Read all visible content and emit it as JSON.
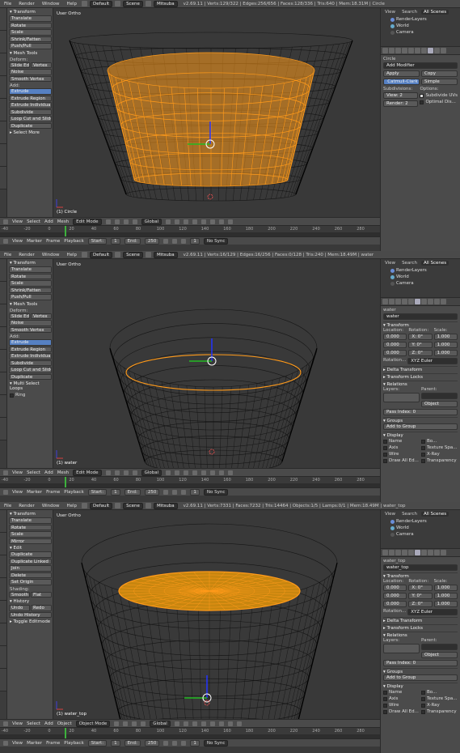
{
  "colors": {
    "selection": "#ff9a1a",
    "wire": "#111111",
    "viewport_bg": "#393939",
    "accent": "#5680c2"
  },
  "top_menu": [
    "File",
    "Render",
    "Window",
    "Help"
  ],
  "frame_numbers": [
    "-40",
    "-20",
    "0",
    "20",
    "40",
    "60",
    "80",
    "100",
    "120",
    "140",
    "160",
    "180",
    "200",
    "220",
    "240",
    "260",
    "280"
  ],
  "playback": {
    "view": "View",
    "marker": "Marker",
    "frame": "Frame",
    "playback": "Playback",
    "start_label": "Start:",
    "start": "1",
    "end_label": "End:",
    "end": "250",
    "current": "1",
    "sync": "No Sync"
  },
  "panels": [
    {
      "layout_label": "Default",
      "scene_label": "Scene",
      "engine_label": "Mitsuba",
      "stats": "v2.69.11 | Verts:129/322 | Edges:256/656 | Faces:128/336 | Tris:640 | Mem:18.31M | Circle",
      "viewport_label": "User Ortho",
      "object_label": "(1) Circle",
      "mode": "Edit Mode",
      "orientation": "Global",
      "header_menus": [
        "View",
        "Select",
        "Add",
        "Mesh"
      ],
      "tools": [
        {
          "kind": "head",
          "text": "▾ Transform"
        },
        {
          "kind": "btn",
          "text": "Translate"
        },
        {
          "kind": "btn",
          "text": "Rotate"
        },
        {
          "kind": "btn",
          "text": "Scale"
        },
        {
          "kind": "btn",
          "text": "Shrink/Fatten"
        },
        {
          "kind": "btn",
          "text": "Push/Pull"
        },
        {
          "kind": "head",
          "text": "▾ Mesh Tools"
        },
        {
          "kind": "label",
          "text": "Deform:"
        },
        {
          "kind": "pair",
          "a": "Slide Ed",
          "b": "Vertex"
        },
        {
          "kind": "btn",
          "text": "Noise"
        },
        {
          "kind": "btn",
          "text": "Smooth Vertex"
        },
        {
          "kind": "label",
          "text": "Add:"
        },
        {
          "kind": "btn",
          "text": "Extrude",
          "sel": true
        },
        {
          "kind": "btn",
          "text": "Extrude Region"
        },
        {
          "kind": "btn",
          "text": "Extrude Individual"
        },
        {
          "kind": "btn",
          "text": "Subdivide"
        },
        {
          "kind": "btn",
          "text": "Loop Cut and Slide"
        },
        {
          "kind": "btn",
          "text": "Duplicate"
        },
        {
          "kind": "head",
          "text": "▸ Select More"
        }
      ],
      "outliner": {
        "tabs": [
          "View",
          "Search",
          "All Scenes"
        ],
        "rows": [
          "RenderLayers",
          "World",
          "Camera"
        ]
      },
      "props": {
        "breadcrumb": "Circle",
        "kind": "modifier",
        "add_modifier": "Add Modifier",
        "apply": "Apply",
        "copy": "Copy",
        "mode_a": "Catmull-Clark",
        "mode_b": "Simple",
        "subdivisions": "Subdivisions:",
        "options": "Options:",
        "view": "View:",
        "view_val": "2",
        "render": "Render:",
        "render_val": "2",
        "opt1": "Subdivide UVs",
        "opt2": "Optimal Dis..."
      }
    },
    {
      "layout_label": "Default",
      "scene_label": "Scene",
      "engine_label": "Mitsuba",
      "stats": "v2.69.11 | Verts:16/129 | Edges:16/256 | Faces:0/128 | Tris:240 | Mem:18.49M | water",
      "viewport_label": "User Ortho",
      "object_label": "(1) water",
      "mode": "Edit Mode",
      "orientation": "Global",
      "header_menus": [
        "View",
        "Select",
        "Add",
        "Mesh"
      ],
      "tools": [
        {
          "kind": "head",
          "text": "▾ Transform"
        },
        {
          "kind": "btn",
          "text": "Translate"
        },
        {
          "kind": "btn",
          "text": "Rotate"
        },
        {
          "kind": "btn",
          "text": "Scale"
        },
        {
          "kind": "btn",
          "text": "Shrink/Fatten"
        },
        {
          "kind": "btn",
          "text": "Push/Pull"
        },
        {
          "kind": "head",
          "text": "▾ Mesh Tools"
        },
        {
          "kind": "label",
          "text": "Deform:"
        },
        {
          "kind": "pair",
          "a": "Slide Ed",
          "b": "Vertex"
        },
        {
          "kind": "btn",
          "text": "Noise"
        },
        {
          "kind": "btn",
          "text": "Smooth Vertex"
        },
        {
          "kind": "label",
          "text": "Add:"
        },
        {
          "kind": "btn",
          "text": "Extrude",
          "sel": true
        },
        {
          "kind": "btn",
          "text": "Extrude Region"
        },
        {
          "kind": "btn",
          "text": "Extrude Individual"
        },
        {
          "kind": "btn",
          "text": "Subdivide"
        },
        {
          "kind": "btn",
          "text": "Loop Cut and Slide"
        },
        {
          "kind": "btn",
          "text": "Duplicate"
        },
        {
          "kind": "head",
          "text": "▾ Multi Select Loops"
        },
        {
          "kind": "check",
          "text": "Ring"
        }
      ],
      "outliner": {
        "tabs": [
          "View",
          "Search",
          "All Scenes"
        ],
        "rows": [
          "RenderLayers",
          "World",
          "Camera"
        ]
      },
      "props": {
        "breadcrumb": "water",
        "kind": "object",
        "name": "water",
        "transform": "▾ Transform",
        "location": "Location:",
        "rotation": "Rotation:",
        "scale": "Scale:",
        "loc": [
          "0.000",
          "0.000",
          "0.000"
        ],
        "rot": [
          "X: 0°",
          "Y: 0°",
          "Z: 0°"
        ],
        "scl": [
          "1.000",
          "1.000",
          "1.000"
        ],
        "rot_mode_label": "Rotation...",
        "rot_mode": "XYZ Euler",
        "delta": "▸ Delta Transform",
        "locks": "▸ Transform Locks",
        "relations": "▾ Relations",
        "layers": "Layers:",
        "parent": "Parent:",
        "parent_type": "Object",
        "pass_index": "Pass Index: 0",
        "groups": "▾ Groups",
        "add_group": "Add to Group",
        "display": "▾ Display",
        "disp_left": [
          "Name",
          "Axis",
          "Wire",
          "Draw All Ed..."
        ],
        "disp_right": [
          "Bo...",
          "Texture Spa...",
          "X-Ray",
          "Transparency"
        ],
        "bounds": "Box"
      }
    },
    {
      "layout_label": "Default",
      "scene_label": "Scene",
      "engine_label": "Mitsuba",
      "stats": "v2.69.11 | Verts:7331 | Faces:7232 | Tris:14464 | Objects:1/5 | Lamps:0/1 | Mem:18.49M | water_top",
      "viewport_label": "User Ortho",
      "object_label": "(1) water_top",
      "mode": "Object Mode",
      "orientation": "Global",
      "header_menus": [
        "View",
        "Select",
        "Add",
        "Object"
      ],
      "tools": [
        {
          "kind": "head",
          "text": "▾ Transform"
        },
        {
          "kind": "btn",
          "text": "Translate"
        },
        {
          "kind": "btn",
          "text": "Rotate"
        },
        {
          "kind": "btn",
          "text": "Scale"
        },
        {
          "kind": "btn",
          "text": "Mirror"
        },
        {
          "kind": "head",
          "text": "▾ Edit"
        },
        {
          "kind": "btn",
          "text": "Duplicate"
        },
        {
          "kind": "btn",
          "text": "Duplicate Linked"
        },
        {
          "kind": "btn",
          "text": "Join"
        },
        {
          "kind": "btn",
          "text": "Delete"
        },
        {
          "kind": "btn",
          "text": "Set Origin"
        },
        {
          "kind": "label",
          "text": "Shading:"
        },
        {
          "kind": "pair",
          "a": "Smooth",
          "b": "Flat"
        },
        {
          "kind": "head",
          "text": "▾ History"
        },
        {
          "kind": "pair",
          "a": "Undo",
          "b": "Redo"
        },
        {
          "kind": "btn",
          "text": "Undo History"
        },
        {
          "kind": "head",
          "text": "▸ Toggle Editmode"
        }
      ],
      "outliner": {
        "tabs": [
          "View",
          "Search",
          "All Scenes"
        ],
        "rows": [
          "RenderLayers",
          "World",
          "Camera"
        ]
      },
      "props": {
        "breadcrumb": "water_top",
        "kind": "object",
        "name": "water_top",
        "transform": "▾ Transform",
        "location": "Location:",
        "rotation": "Rotation:",
        "scale": "Scale:",
        "loc": [
          "0.000",
          "0.000",
          "0.000"
        ],
        "rot": [
          "X: 0°",
          "Y: 0°",
          "Z: 0°"
        ],
        "scl": [
          "1.000",
          "1.000",
          "1.000"
        ],
        "rot_mode_label": "Rotation...",
        "rot_mode": "XYZ Euler",
        "delta": "▸ Delta Transform",
        "locks": "▸ Transform Locks",
        "relations": "▾ Relations",
        "layers": "Layers:",
        "parent": "Parent:",
        "parent_type": "Object",
        "pass_index": "Pass Index: 0",
        "groups": "▾ Groups",
        "add_group": "Add to Group",
        "display": "▾ Display",
        "disp_left": [
          "Name",
          "Axis",
          "Wire",
          "Draw All Ed..."
        ],
        "disp_right": [
          "Bo...",
          "Texture Spa...",
          "X-Ray",
          "Transparency"
        ],
        "bounds": "Box"
      }
    }
  ]
}
